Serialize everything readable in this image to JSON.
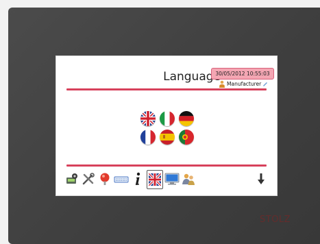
{
  "screen": {
    "title": "Language",
    "datetime": "30/05/2012 10:55:03",
    "user": "Manufacturer"
  },
  "brand": "STOLZ",
  "languages": [
    {
      "id": "english",
      "icon": "flag-uk-icon"
    },
    {
      "id": "italian",
      "icon": "flag-italy-icon"
    },
    {
      "id": "german",
      "icon": "flag-germany-icon"
    },
    {
      "id": "french",
      "icon": "flag-france-icon"
    },
    {
      "id": "spanish",
      "icon": "flag-spain-icon"
    },
    {
      "id": "portuguese",
      "icon": "flag-portugal-icon"
    }
  ],
  "toolbar": [
    {
      "icon": "machine-icon"
    },
    {
      "icon": "tools-icon"
    },
    {
      "icon": "alarm-icon"
    },
    {
      "icon": "keyboard-icon"
    },
    {
      "icon": "info-icon"
    },
    {
      "icon": "language-flag-icon",
      "selected": true
    },
    {
      "icon": "monitor-icon"
    },
    {
      "icon": "users-icon"
    },
    {
      "icon": "down-arrow-icon"
    }
  ],
  "colors": {
    "accent": "#d7415b",
    "badge": "#f4a6b3",
    "bezel": "#434343"
  }
}
